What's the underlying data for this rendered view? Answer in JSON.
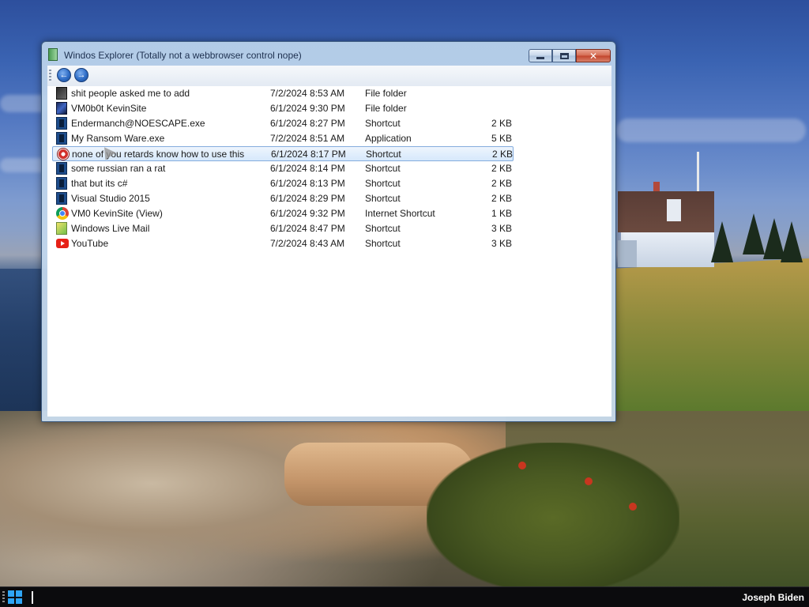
{
  "window": {
    "title": "Windos Explorer (Totally not a webbrowser control nope)",
    "close_glyph": "✕"
  },
  "toolbar": {
    "back_glyph": "←",
    "forward_glyph": "→"
  },
  "files": [
    {
      "name": "shit people asked me to add",
      "date": "7/2/2024 8:53 AM",
      "type": "File folder",
      "size": "",
      "icon": "folder-icon"
    },
    {
      "name": "VM0b0t KevinSite",
      "date": "6/1/2024 9:30 PM",
      "type": "File folder",
      "size": "",
      "icon": "vm-folder-icon"
    },
    {
      "name": "Endermanch@NOESCAPE.exe",
      "date": "6/1/2024 8:27 PM",
      "type": "Shortcut",
      "size": "2 KB",
      "icon": "shortcut-icon"
    },
    {
      "name": "My Ransom Ware.exe",
      "date": "7/2/2024 8:51 AM",
      "type": "Application",
      "size": "5 KB",
      "icon": "application-icon"
    },
    {
      "name": "none of you retards know how to use this",
      "date": "6/1/2024 8:17 PM",
      "type": "Shortcut",
      "size": "2 KB",
      "icon": "ransom-shortcut-icon"
    },
    {
      "name": "some russian ran a rat",
      "date": "6/1/2024 8:14 PM",
      "type": "Shortcut",
      "size": "2 KB",
      "icon": "shortcut-icon"
    },
    {
      "name": "that but its c#",
      "date": "6/1/2024 8:13 PM",
      "type": "Shortcut",
      "size": "2 KB",
      "icon": "shortcut-icon"
    },
    {
      "name": "Visual Studio 2015",
      "date": "6/1/2024 8:29 PM",
      "type": "Shortcut",
      "size": "2 KB",
      "icon": "shortcut-icon"
    },
    {
      "name": "VM0 KevinSite (View)",
      "date": "6/1/2024 9:32 PM",
      "type": "Internet Shortcut",
      "size": "1 KB",
      "icon": "chrome-icon"
    },
    {
      "name": "Windows Live Mail",
      "date": "6/1/2024 8:47 PM",
      "type": "Shortcut",
      "size": "3 KB",
      "icon": "mail-icon"
    },
    {
      "name": "YouTube",
      "date": "7/2/2024 8:43 AM",
      "type": "Shortcut",
      "size": "3 KB",
      "icon": "youtube-icon"
    }
  ],
  "selected_index": 4,
  "taskbar": {
    "user": "Joseph Biden"
  }
}
